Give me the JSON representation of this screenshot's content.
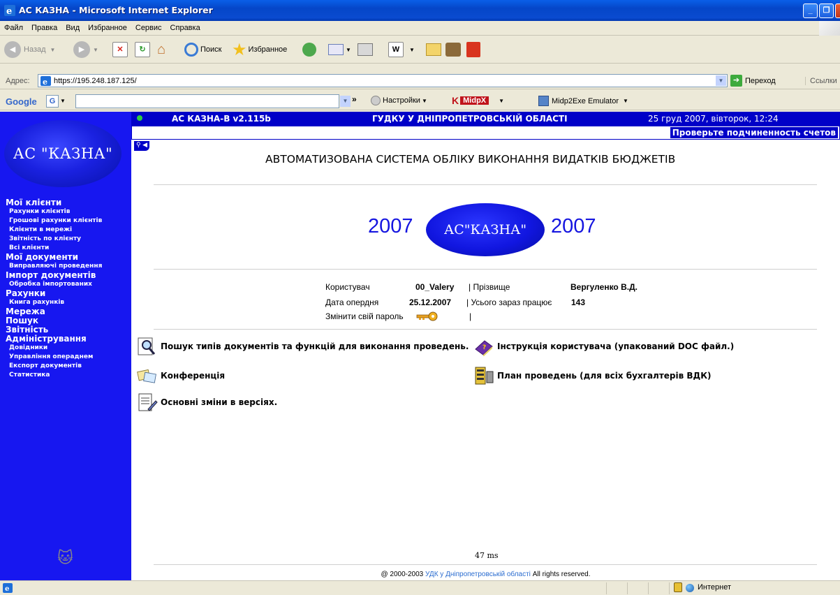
{
  "window": {
    "title": "АС КАЗНА - Microsoft Internet Explorer"
  },
  "menu": [
    "Файл",
    "Правка",
    "Вид",
    "Избранное",
    "Сервис",
    "Справка"
  ],
  "toolbar": {
    "back": "Назад",
    "search": "Поиск",
    "favorites": "Избранное"
  },
  "address": {
    "label": "Адрес:",
    "url": "https://195.248.187.125/",
    "go": "Переход",
    "links": "Ссылки"
  },
  "googlebar": {
    "logo": "Google",
    "settings": "Настройки",
    "midpx": "MidpX",
    "emulator": "Midp2Exe Emulator"
  },
  "sidebar": {
    "logo": "АС \"КАЗНА\"",
    "nav": [
      {
        "label": "Мої клієнти",
        "level": "h"
      },
      {
        "label": "Рахунки клієнтів",
        "level": "s"
      },
      {
        "label": "Грошові рахунки клієнтів",
        "level": "s"
      },
      {
        "label": "Клієнти в мережі",
        "level": "s"
      },
      {
        "label": "Звітність по клієнту",
        "level": "s"
      },
      {
        "label": "Всі клієнти",
        "level": "s"
      },
      {
        "label": "Мої документи",
        "level": "h"
      },
      {
        "label": "Виправляючі проведення",
        "level": "s"
      },
      {
        "label": "Імпорт документів",
        "level": "h"
      },
      {
        "label": "Обробка імпортованих",
        "level": "s"
      },
      {
        "label": "Рахунки",
        "level": "h"
      },
      {
        "label": "Книга рахунків",
        "level": "s"
      },
      {
        "label": "Мережа",
        "level": "h"
      },
      {
        "label": "Пошук",
        "level": "h"
      },
      {
        "label": "Звітність",
        "level": "h"
      },
      {
        "label": "Адміністрування",
        "level": "h"
      },
      {
        "label": "Довідники",
        "level": "s"
      },
      {
        "label": "Управління операднем",
        "level": "s"
      },
      {
        "label": "Експорт документів",
        "level": "s"
      },
      {
        "label": "Статистика",
        "level": "s"
      }
    ]
  },
  "header": {
    "version": "АС КАЗНА-В v2.115b",
    "org": "ГУДКУ У ДНІПРОПЕТРОВСЬКІЙ ОБЛАСТІ",
    "datetime": "25 груд 2007, вівторок, 12:24",
    "message": "Проверьте подчиненность счетов"
  },
  "main": {
    "title": "АВТОМАТИЗОВАНА СИСТЕМА ОБЛІКУ ВИКОНАННЯ ВИДАТКІВ БЮДЖЕТІВ",
    "year": "2007",
    "logo": "АС\"КАЗНА\"",
    "user_label": "Користувач",
    "user_value": "00_Valery",
    "surname_label": "| Прізвище",
    "surname_value": "Вергуленко В.Д.",
    "opday_label": "Дата опердня",
    "opday_value": "25.12.2007",
    "working_label": "| Усього зараз працює",
    "working_value": "143",
    "change_password": "Змінити свій пароль",
    "bar": "|",
    "links": {
      "search_docs": "Пошук типів документів та функцій для виконання проведень.",
      "manual": "Інструкція користувача (упакований DOC файл.)",
      "conference": "Конференція",
      "plan": "План проведень (для всіх бухгалтерів ВДК)",
      "changes": "Основні зміни в версіях."
    },
    "timing": "47 ms",
    "copyright_pre": "@ 2000-2003",
    "copyright_link": "УДК у Дніпропетровській області",
    "copyright_post": "All rights reserved."
  },
  "status": {
    "zone": "Интернет"
  },
  "colors": {
    "sidebar": "#1717F0",
    "header": "#0000C8",
    "accent_text": "#1515E0"
  }
}
